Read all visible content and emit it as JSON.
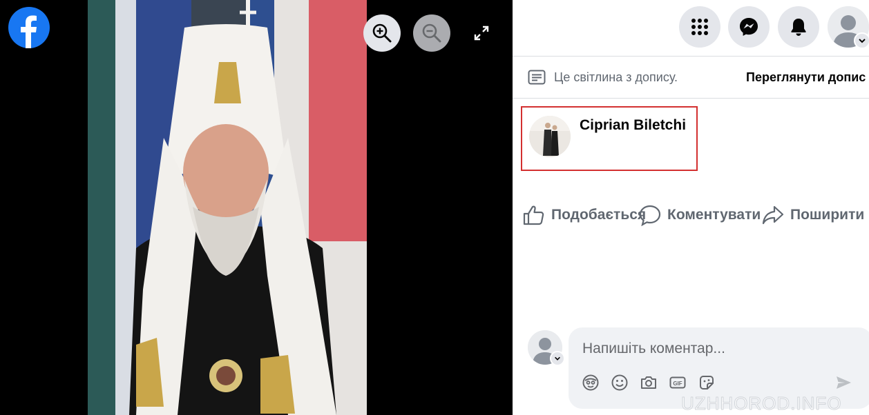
{
  "viewer": {
    "logo_icon": "facebook-logo",
    "zoom_in_icon": "zoom-in-icon",
    "zoom_out_icon": "zoom-out-icon",
    "fullscreen_icon": "fullscreen-icon",
    "photo_description_icon": "photo"
  },
  "topbar": {
    "menu_icon": "grid-menu-icon",
    "messenger_icon": "messenger-icon",
    "notifications_icon": "bell-icon",
    "account_icon": "account-avatar"
  },
  "notice": {
    "text": "Це світлина з допису.",
    "link": "Переглянути допис"
  },
  "post": {
    "author": "Ciprian Biletchi"
  },
  "actions": {
    "like": "Подобається",
    "comment": "Коментувати",
    "share": "Поширити"
  },
  "composer": {
    "placeholder": "Напишіть коментар..."
  },
  "watermark": "UZHHOROD.INFO",
  "colors": {
    "brand": "#1877F2",
    "highlight_border": "#D32F2F",
    "panel_bg": "#FFFFFF",
    "viewer_bg": "#000000"
  }
}
